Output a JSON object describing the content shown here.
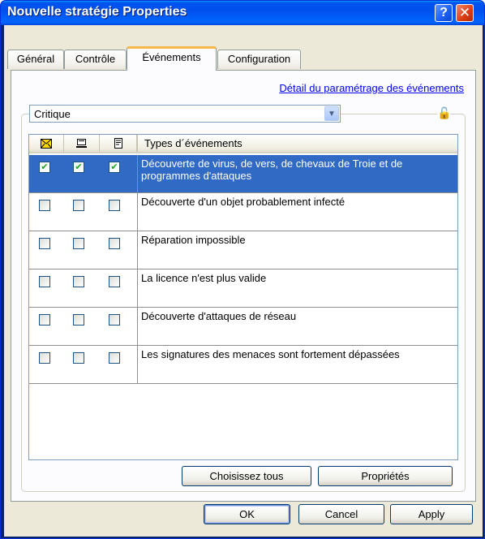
{
  "window": {
    "title": "Nouvelle stratégie Properties",
    "help_label": "?",
    "close_label": "✕"
  },
  "tabs": [
    {
      "label": "Général",
      "active": false
    },
    {
      "label": "Contrôle",
      "active": false
    },
    {
      "label": "Événements",
      "active": true
    },
    {
      "label": "Configuration",
      "active": false
    }
  ],
  "panel": {
    "link_text": "Détail du paramétrage des événements",
    "severity_select": {
      "value": "Critique"
    },
    "grid": {
      "header_icons": [
        "mail-icon",
        "monitor-icon",
        "log-icon"
      ],
      "header_text": "Types d´événements",
      "rows": [
        {
          "text": "Découverte de virus, de vers, de chevaux de Troie et de programmes d'attaques",
          "checks": [
            true,
            true,
            true
          ],
          "selected": true
        },
        {
          "text": "Découverte d'un objet probablement infecté",
          "checks": [
            false,
            false,
            false
          ],
          "selected": false
        },
        {
          "text": "Réparation impossible",
          "checks": [
            false,
            false,
            false
          ],
          "selected": false
        },
        {
          "text": "La licence n'est plus valide",
          "checks": [
            false,
            false,
            false
          ],
          "selected": false
        },
        {
          "text": "Découverte d'attaques de réseau",
          "checks": [
            false,
            false,
            false
          ],
          "selected": false
        },
        {
          "text": "Les signatures des menaces sont fortement dépassées",
          "checks": [
            false,
            false,
            false
          ],
          "selected": false
        }
      ]
    },
    "select_all_label": "Choisissez tous",
    "properties_label": "Propriétés"
  },
  "footer": {
    "ok_label": "OK",
    "cancel_label": "Cancel",
    "apply_label": "Apply"
  },
  "colors": {
    "selection": "#316ac5",
    "titlebar": "#0053ee",
    "link": "#0000ee"
  }
}
